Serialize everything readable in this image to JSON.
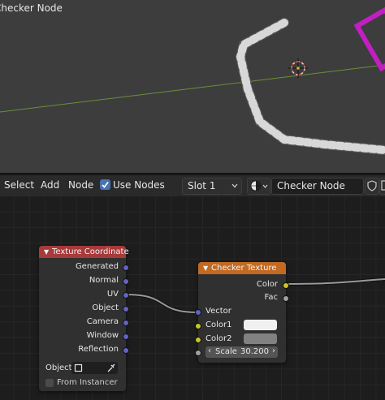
{
  "viewport": {
    "title": "Checker Node"
  },
  "header": {
    "menus": [
      "Select",
      "Add",
      "Node"
    ],
    "use_nodes_label": "Use Nodes",
    "slot_value": "Slot 1",
    "material_name": "Checker Node"
  },
  "nodes": {
    "texture_coordinate": {
      "title": "Texture Coordinate",
      "outputs": [
        "Generated",
        "Normal",
        "UV",
        "Object",
        "Camera",
        "Window",
        "Reflection"
      ],
      "object_label": "Object:",
      "from_instancer_label": "From Instancer"
    },
    "checker_texture": {
      "title": "Checker Texture",
      "outputs": [
        "Color",
        "Fac"
      ],
      "inputs": [
        "Vector",
        "Color1",
        "Color2"
      ],
      "scale_label": "Scale",
      "scale_value": "30.200"
    }
  },
  "colors": {
    "texture_coord_header": "#a83a3a",
    "checker_header": "#c26a22",
    "accent": "#4772b3",
    "vector_socket": "#6363c7",
    "color_socket": "#c7c729",
    "float_socket": "#a1a1a1",
    "color1_swatch": "#f0f0f0",
    "color2_swatch": "#818181",
    "selection_magenta": "#c21fc2"
  }
}
